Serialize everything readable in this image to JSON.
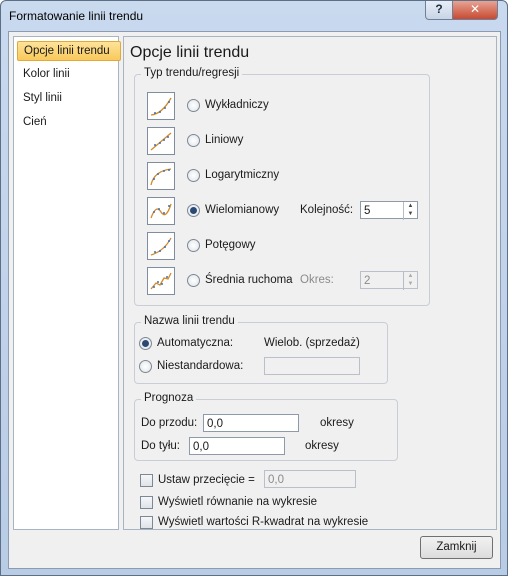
{
  "window": {
    "title": "Formatowanie linii trendu",
    "help_glyph": "?",
    "close_glyph": "✕"
  },
  "nav": {
    "items": [
      {
        "label": "Opcje linii trendu",
        "selected": true
      },
      {
        "label": "Kolor linii",
        "selected": false
      },
      {
        "label": "Styl linii",
        "selected": false
      },
      {
        "label": "Cień",
        "selected": false
      }
    ]
  },
  "panel": {
    "title": "Opcje linii trendu",
    "trend_type": {
      "label": "Typ trendu/regresji",
      "options": [
        {
          "label": "Wykładniczy",
          "icon": "exponential-trend-icon",
          "selected": false
        },
        {
          "label": "Liniowy",
          "icon": "linear-trend-icon",
          "selected": false
        },
        {
          "label": "Logarytmiczny",
          "icon": "logarithmic-trend-icon",
          "selected": false
        },
        {
          "label": "Wielomianowy",
          "icon": "polynomial-trend-icon",
          "selected": true
        },
        {
          "label": "Potęgowy",
          "icon": "power-trend-icon",
          "selected": false
        },
        {
          "label": "Średnia ruchoma",
          "icon": "moving-average-trend-icon",
          "selected": false
        }
      ],
      "order_label": "Kolejność:",
      "order_value": "5",
      "period_label": "Okres:",
      "period_value": "2"
    },
    "trend_name": {
      "label": "Nazwa linii trendu",
      "automatic_label": "Automatyczna:",
      "automatic_value": "Wielob. (sprzedaż)",
      "custom_label": "Niestandardowa:",
      "custom_value": ""
    },
    "forecast": {
      "label": "Prognoza",
      "forward_label": "Do przodu:",
      "forward_value": "0,0",
      "forward_unit": "okresy",
      "backward_label": "Do tyłu:",
      "backward_value": "0,0",
      "backward_unit": "okresy"
    },
    "intercept_label": "Ustaw przecięcie =",
    "intercept_value": "0,0",
    "show_equation_label": "Wyświetl równanie na wykresie",
    "show_rsquared_label": "Wyświetl wartości R-kwadrat na wykresie"
  },
  "footer": {
    "close_label": "Zamknij"
  },
  "colors": {
    "selected_nav_fill": "#f9c95a",
    "trend_line": "#d38a28",
    "trend_points": "#3f6fb0"
  }
}
